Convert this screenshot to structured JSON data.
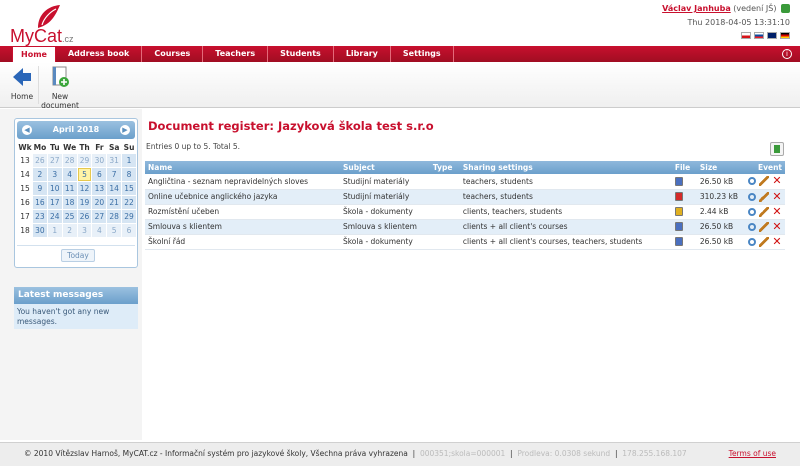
{
  "header": {
    "logo_text": "MyCat",
    "logo_suffix": ".cz",
    "user_name": "Václav Janhuba",
    "user_role": "(vedení JŠ)",
    "datetime": "Thu 2018-04-05 13:31:10"
  },
  "nav": [
    "Home",
    "Address book",
    "Courses",
    "Teachers",
    "Students",
    "Library",
    "Settings"
  ],
  "toolbar": {
    "home_label": "Home",
    "new_doc_label_1": "New",
    "new_doc_label_2": "document"
  },
  "calendar": {
    "month": "April 2018",
    "weekday_header": [
      "Wk",
      "Mo",
      "Tu",
      "We",
      "Th",
      "Fr",
      "Sa",
      "Su"
    ],
    "today_label": "Today"
  },
  "messages": {
    "title": "Latest messages",
    "body": "You haven't got any new messages."
  },
  "main": {
    "title": "Document register: Jazyková škola test s.r.o",
    "entries": "Entries 0 up to 5. Total 5.",
    "columns": [
      "Name",
      "Subject",
      "Type",
      "Sharing settings",
      "File",
      "Size",
      "Event"
    ],
    "rows": [
      {
        "name": "Angličtina - seznam nepravidelných sloves",
        "subject": "Studijní materiály",
        "type": "",
        "sharing": "teachers, students",
        "file": "doc-icon",
        "size": "26.50 kB"
      },
      {
        "name": "Online učebnice anglického jazyka",
        "subject": "Studijní materiály",
        "type": "",
        "sharing": "teachers, students",
        "file": "pdf-icon",
        "size": "310.23 kB"
      },
      {
        "name": "Rozmístění učeben",
        "subject": "Škola - dokumenty",
        "type": "",
        "sharing": "clients, teachers, students",
        "file": "image-icon",
        "size": "2.44 kB"
      },
      {
        "name": "Smlouva s klientem",
        "subject": "Smlouva s klientem",
        "type": "",
        "sharing": "clients + all client's courses",
        "file": "doc-icon",
        "size": "26.50 kB"
      },
      {
        "name": "Školní řád",
        "subject": "Škola - dokumenty",
        "type": "",
        "sharing": "clients + all client's courses, teachers, students",
        "file": "doc-icon",
        "size": "26.50 kB"
      }
    ]
  },
  "footer": {
    "copyright": "© 2010 Vítězslav Harnoš, MyCAT.cz - Informační systém pro jazykové školy, Všechna práva vyhrazena",
    "meta_1": "000351;skola=000001",
    "meta_2": "Prodleva: 0.0308 sekund",
    "meta_3": "178.255.168.107",
    "terms": "Terms of use"
  },
  "colors": {
    "brand": "#c8102e",
    "accent": "#6b9fcb"
  }
}
